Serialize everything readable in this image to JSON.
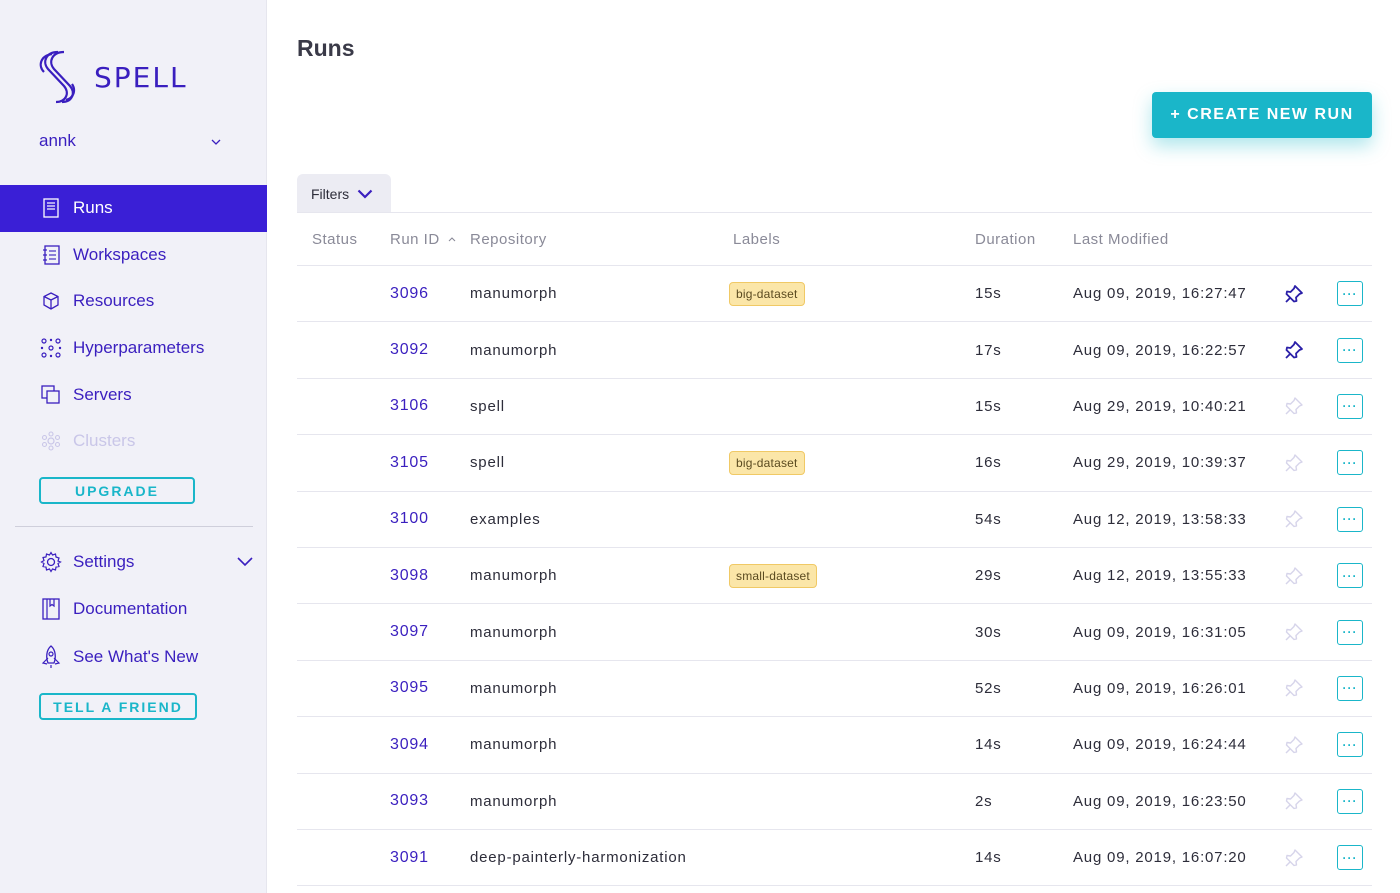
{
  "app": {
    "name": "SPELL"
  },
  "user": {
    "name": "annk"
  },
  "colors": {
    "accent": "#3a1fd6",
    "teal": "#1ab6c9",
    "badge": "#fbe6a8"
  },
  "nav": [
    {
      "label": "Runs",
      "icon": "document-icon",
      "active": true
    },
    {
      "label": "Workspaces",
      "icon": "notebook-icon"
    },
    {
      "label": "Resources",
      "icon": "cube-icon"
    },
    {
      "label": "Hyperparameters",
      "icon": "nodes-icon"
    },
    {
      "label": "Servers",
      "icon": "copy-icon"
    },
    {
      "label": "Clusters",
      "icon": "cluster-icon",
      "disabled": true
    }
  ],
  "upgrade_label": "UPGRADE",
  "nav2": [
    {
      "label": "Settings",
      "icon": "gear-icon"
    },
    {
      "label": "Documentation",
      "icon": "book-icon"
    },
    {
      "label": "See What's New",
      "icon": "rocket-icon"
    }
  ],
  "tell_label": "TELL A FRIEND",
  "page": {
    "title": "Runs",
    "create_label": "+ CREATE NEW RUN",
    "filters_label": "Filters"
  },
  "table": {
    "headers": {
      "status": "Status",
      "run_id": "Run ID",
      "repository": "Repository",
      "labels": "Labels",
      "duration": "Duration",
      "last_modified": "Last Modified"
    },
    "rows": [
      {
        "id": "3096",
        "repo": "manumorph",
        "label": "big-dataset",
        "duration": "15s",
        "modified": "Aug 09, 2019, 16:27:47",
        "pinned": true
      },
      {
        "id": "3092",
        "repo": "manumorph",
        "label": "",
        "duration": "17s",
        "modified": "Aug 09, 2019, 16:22:57",
        "pinned": true
      },
      {
        "id": "3106",
        "repo": "spell",
        "label": "",
        "duration": "15s",
        "modified": "Aug 29, 2019, 10:40:21",
        "pinned": false
      },
      {
        "id": "3105",
        "repo": "spell",
        "label": "big-dataset",
        "duration": "16s",
        "modified": "Aug 29, 2019, 10:39:37",
        "pinned": false
      },
      {
        "id": "3100",
        "repo": "examples",
        "label": "",
        "duration": "54s",
        "modified": "Aug 12, 2019, 13:58:33",
        "pinned": false
      },
      {
        "id": "3098",
        "repo": "manumorph",
        "label": "small-dataset",
        "duration": "29s",
        "modified": "Aug 12, 2019, 13:55:33",
        "pinned": false
      },
      {
        "id": "3097",
        "repo": "manumorph",
        "label": "",
        "duration": "30s",
        "modified": "Aug 09, 2019, 16:31:05",
        "pinned": false
      },
      {
        "id": "3095",
        "repo": "manumorph",
        "label": "",
        "duration": "52s",
        "modified": "Aug 09, 2019, 16:26:01",
        "pinned": false
      },
      {
        "id": "3094",
        "repo": "manumorph",
        "label": "",
        "duration": "14s",
        "modified": "Aug 09, 2019, 16:24:44",
        "pinned": false
      },
      {
        "id": "3093",
        "repo": "manumorph",
        "label": "",
        "duration": "2s",
        "modified": "Aug 09, 2019, 16:23:50",
        "pinned": false
      },
      {
        "id": "3091",
        "repo": "deep-painterly-harmonization",
        "label": "",
        "duration": "14s",
        "modified": "Aug 09, 2019, 16:07:20",
        "pinned": false
      }
    ],
    "more_label": "···"
  }
}
